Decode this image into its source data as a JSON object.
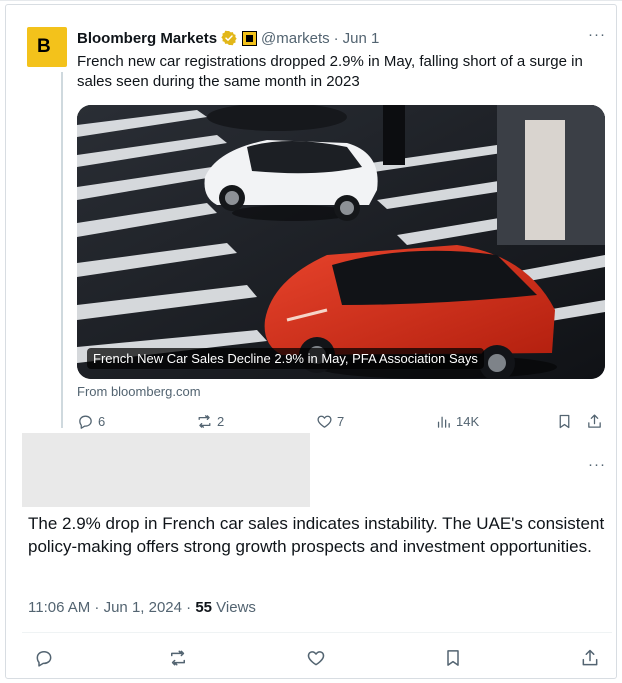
{
  "quoted_tweet": {
    "avatar_letter": "B",
    "author_name": "Bloomberg Markets",
    "handle": "@markets",
    "separator": "·",
    "date": "Jun 1",
    "more_label": "···",
    "text": "French new car registrations dropped 2.9% in May, falling short of a surge in sales seen during the same month in 2023",
    "media_caption": "French New Car Sales Decline 2.9% in May, PFA Association Says",
    "source_link": "From bloomberg.com",
    "actions": {
      "replies": "6",
      "reposts": "2",
      "likes": "7",
      "views": "14K"
    }
  },
  "reply_tweet": {
    "more_label": "···",
    "text": "The 2.9% drop in French car sales indicates instability. The UAE's consistent policy-making offers strong growth prospects and investment opportunities.",
    "time": "11:06 AM · Jun 1, 2024 · ",
    "views_count": "55",
    "views_label": " Views"
  },
  "colors": {
    "text_primary": "#0f1419",
    "text_secondary": "#536471",
    "verified_gold": "#e2b719",
    "bloomberg_yellow": "#f3c21b"
  }
}
